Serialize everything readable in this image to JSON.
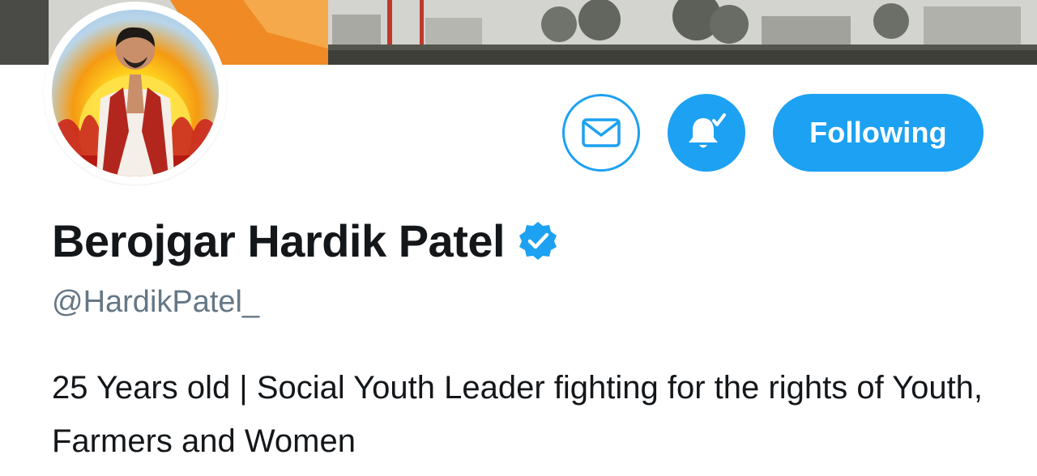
{
  "banner": {
    "icon": "crowd-banner-image"
  },
  "avatar": {
    "icon": "profile-photo"
  },
  "actions": {
    "message_icon": "envelope-icon",
    "notify_icon": "bell-check-icon",
    "following_label": "Following"
  },
  "profile": {
    "display_name": "Berojgar Hardik Patel",
    "verified_icon": "verified-badge-icon",
    "handle": "@HardikPatel_",
    "bio": "25 Years old | Social Youth Leader fighting for the rights of Youth, Farmers and Women"
  },
  "colors": {
    "accent": "#1da1f2",
    "text_primary": "#14171a",
    "text_secondary": "#657786"
  }
}
